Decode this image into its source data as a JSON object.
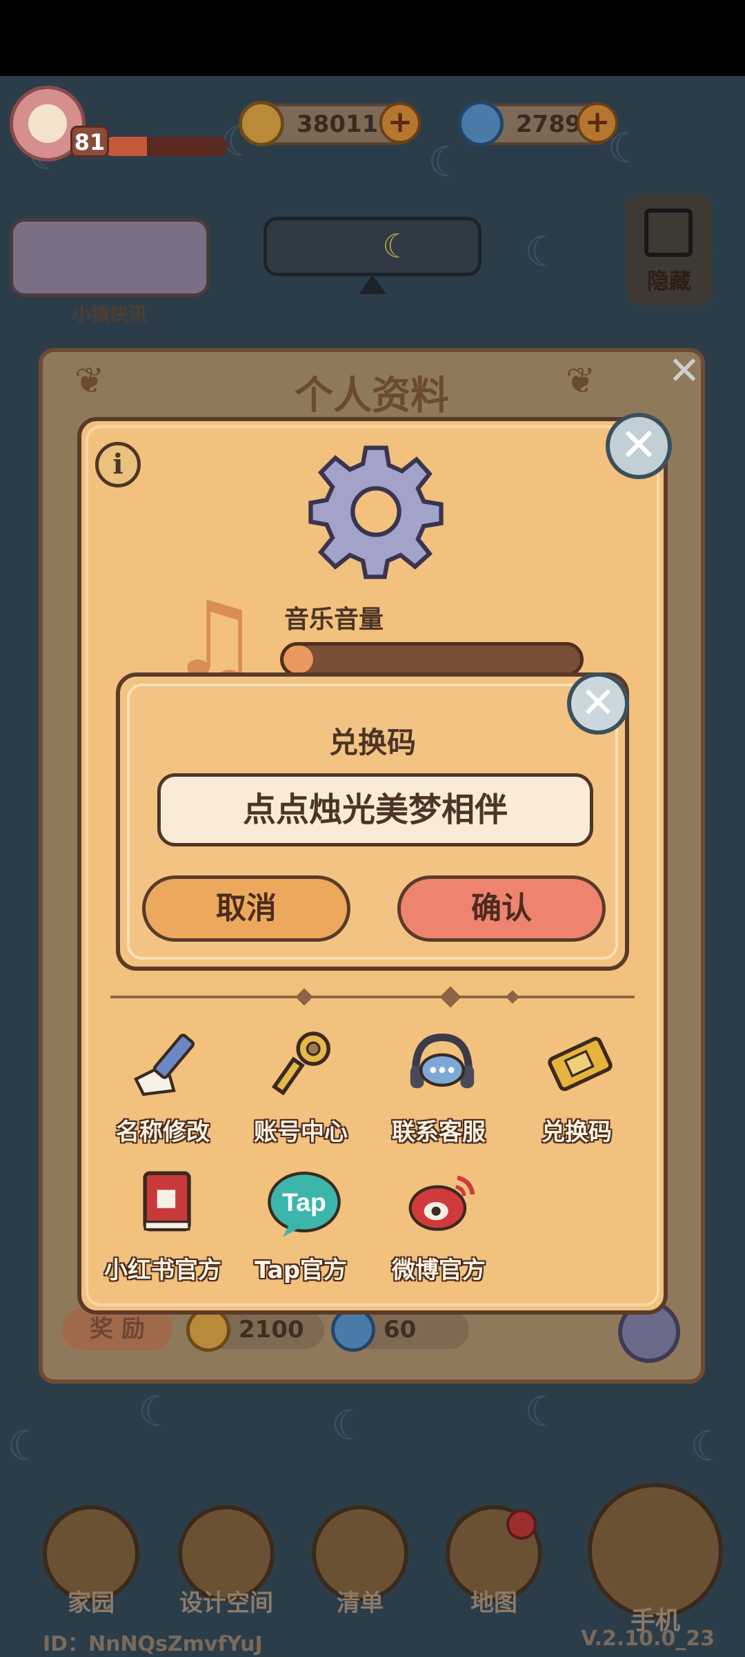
{
  "hud": {
    "level": "81",
    "xp_progress": 0.35,
    "coins": "38011",
    "gems": "2789"
  },
  "news_label": "小镇快讯",
  "hide_label": "隐藏",
  "profile": {
    "title": "个人资料",
    "reward_label": "奖 励",
    "reward_coins": "2100",
    "reward_gems": "60"
  },
  "settings": {
    "volume_label": "音乐音量",
    "volume_level": 0.1,
    "icons_row1": [
      "名称修改",
      "账号中心",
      "联系客服",
      "兑换码"
    ],
    "icons_row2": [
      "小红书官方",
      "Tap官方",
      "微博官方"
    ]
  },
  "redeem": {
    "title": "兑换码",
    "code_value": "点点烛光美梦相伴",
    "cancel_label": "取消",
    "confirm_label": "确认"
  },
  "nav": {
    "items": [
      "家园",
      "设计空间",
      "清单",
      "地图"
    ],
    "phone_label": "手机"
  },
  "footer": {
    "id": "ID：NnNQsZmvfYuJ",
    "version": "V.2.10.0_23"
  },
  "colors": {
    "panel": "#f2c17e",
    "confirm": "#ee8370",
    "cancel": "#eca95e"
  }
}
